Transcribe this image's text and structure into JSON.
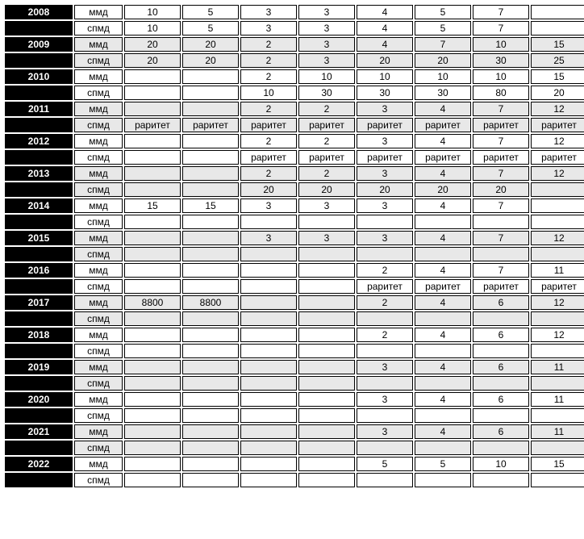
{
  "rows": [
    {
      "year": "2008",
      "mint": "ммд",
      "shade": false,
      "cells": [
        "10",
        "5",
        "3",
        "3",
        "4",
        "5",
        "7",
        ""
      ]
    },
    {
      "year": "",
      "mint": "спмд",
      "shade": false,
      "cells": [
        "10",
        "5",
        "3",
        "3",
        "4",
        "5",
        "7",
        ""
      ]
    },
    {
      "year": "2009",
      "mint": "ммд",
      "shade": true,
      "cells": [
        "20",
        "20",
        "2",
        "3",
        "4",
        "7",
        "10",
        "15"
      ]
    },
    {
      "year": "",
      "mint": "спмд",
      "shade": true,
      "cells": [
        "20",
        "20",
        "2",
        "3",
        "20",
        "20",
        "30",
        "25"
      ]
    },
    {
      "year": "2010",
      "mint": "ммд",
      "shade": false,
      "cells": [
        "",
        "",
        "2",
        "10",
        "10",
        "10",
        "10",
        "15"
      ]
    },
    {
      "year": "",
      "mint": "спмд",
      "shade": false,
      "cells": [
        "",
        "",
        "10",
        "30",
        "30",
        "30",
        "80",
        "20"
      ]
    },
    {
      "year": "2011",
      "mint": "ммд",
      "shade": true,
      "cells": [
        "",
        "",
        "2",
        "2",
        "3",
        "4",
        "7",
        "12"
      ]
    },
    {
      "year": "",
      "mint": "спмд",
      "shade": true,
      "cells": [
        "раритет",
        "раритет",
        "раритет",
        "раритет",
        "раритет",
        "раритет",
        "раритет",
        "раритет"
      ]
    },
    {
      "year": "2012",
      "mint": "ммд",
      "shade": false,
      "cells": [
        "",
        "",
        "2",
        "2",
        "3",
        "4",
        "7",
        "12"
      ]
    },
    {
      "year": "",
      "mint": "спмд",
      "shade": false,
      "cells": [
        "",
        "",
        "раритет",
        "раритет",
        "раритет",
        "раритет",
        "раритет",
        "раритет"
      ]
    },
    {
      "year": "2013",
      "mint": "ммд",
      "shade": true,
      "cells": [
        "",
        "",
        "2",
        "2",
        "3",
        "4",
        "7",
        "12"
      ]
    },
    {
      "year": "",
      "mint": "спмд",
      "shade": true,
      "cells": [
        "",
        "",
        "20",
        "20",
        "20",
        "20",
        "20",
        ""
      ]
    },
    {
      "year": "2014",
      "mint": "ммд",
      "shade": false,
      "cells": [
        "15",
        "15",
        "3",
        "3",
        "3",
        "4",
        "7",
        ""
      ]
    },
    {
      "year": "",
      "mint": "спмд",
      "shade": false,
      "cells": [
        "",
        "",
        "",
        "",
        "",
        "",
        "",
        ""
      ]
    },
    {
      "year": "2015",
      "mint": "ммд",
      "shade": true,
      "cells": [
        "",
        "",
        "3",
        "3",
        "3",
        "4",
        "7",
        "12"
      ]
    },
    {
      "year": "",
      "mint": "спмд",
      "shade": true,
      "cells": [
        "",
        "",
        "",
        "",
        "",
        "",
        "",
        ""
      ]
    },
    {
      "year": "2016",
      "mint": "ммд",
      "shade": false,
      "cells": [
        "",
        "",
        "",
        "",
        "2",
        "4",
        "7",
        "11"
      ]
    },
    {
      "year": "",
      "mint": "спмд",
      "shade": false,
      "cells": [
        "",
        "",
        "",
        "",
        "раритет",
        "раритет",
        "раритет",
        "раритет"
      ]
    },
    {
      "year": "2017",
      "mint": "ммд",
      "shade": true,
      "cells": [
        "8800",
        "8800",
        "",
        "",
        "2",
        "4",
        "6",
        "12"
      ]
    },
    {
      "year": "",
      "mint": "спмд",
      "shade": true,
      "cells": [
        "",
        "",
        "",
        "",
        "",
        "",
        "",
        ""
      ]
    },
    {
      "year": "2018",
      "mint": "ммд",
      "shade": false,
      "cells": [
        "",
        "",
        "",
        "",
        "2",
        "4",
        "6",
        "12"
      ]
    },
    {
      "year": "",
      "mint": "спмд",
      "shade": false,
      "cells": [
        "",
        "",
        "",
        "",
        "",
        "",
        "",
        ""
      ]
    },
    {
      "year": "2019",
      "mint": "ммд",
      "shade": true,
      "cells": [
        "",
        "",
        "",
        "",
        "3",
        "4",
        "6",
        "11"
      ]
    },
    {
      "year": "",
      "mint": "спмд",
      "shade": true,
      "cells": [
        "",
        "",
        "",
        "",
        "",
        "",
        "",
        ""
      ]
    },
    {
      "year": "2020",
      "mint": "ммд",
      "shade": false,
      "cells": [
        "",
        "",
        "",
        "",
        "3",
        "4",
        "6",
        "11"
      ]
    },
    {
      "year": "",
      "mint": "спмд",
      "shade": false,
      "cells": [
        "",
        "",
        "",
        "",
        "",
        "",
        "",
        ""
      ]
    },
    {
      "year": "2021",
      "mint": "ммд",
      "shade": true,
      "cells": [
        "",
        "",
        "",
        "",
        "3",
        "4",
        "6",
        "11"
      ]
    },
    {
      "year": "",
      "mint": "спмд",
      "shade": true,
      "cells": [
        "",
        "",
        "",
        "",
        "",
        "",
        "",
        ""
      ]
    },
    {
      "year": "2022",
      "mint": "ммд",
      "shade": false,
      "cells": [
        "",
        "",
        "",
        "",
        "5",
        "5",
        "10",
        "15"
      ]
    },
    {
      "year": "",
      "mint": "спмд",
      "shade": false,
      "cells": [
        "",
        "",
        "",
        "",
        "",
        "",
        "",
        ""
      ]
    }
  ]
}
